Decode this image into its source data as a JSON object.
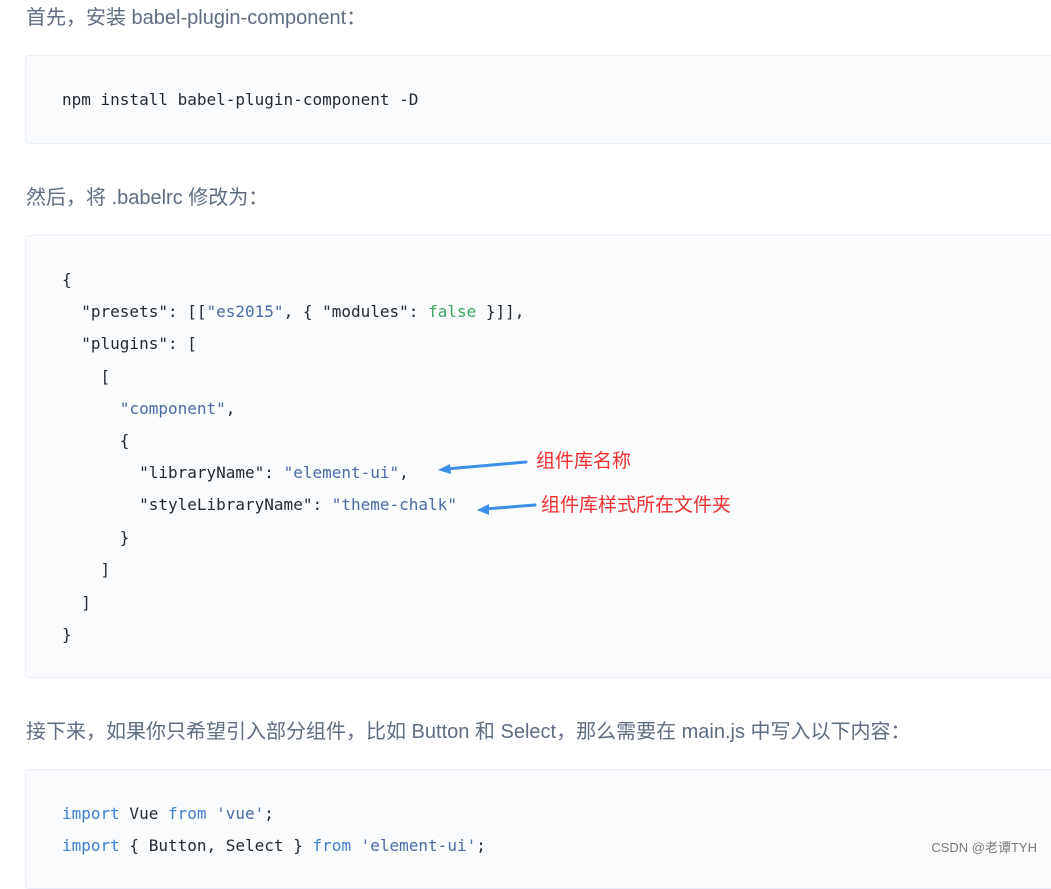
{
  "paragraphs": {
    "install_intro": "首先，安装 babel-plugin-component：",
    "babelrc_intro": "然后，将 .babelrc 修改为：",
    "import_intro": "接下来，如果你只希望引入部分组件，比如 Button 和 Select，那么需要在 main.js 中写入以下内容："
  },
  "install_command": "npm install babel-plugin-component -D",
  "babelrc_code": [
    "{",
    "  \"presets\": [[\"es2015\", { \"modules\": false }]],",
    "  \"plugins\": [",
    "    [",
    "      \"component\",",
    "      {",
    "        \"libraryName\": \"element-ui\",",
    "        \"styleLibraryName\": \"theme-chalk\"",
    "      }",
    "    ]",
    "  ]",
    "}"
  ],
  "tokens": {
    "open_brace": "{",
    "close_brace": "}",
    "open_bracket": "[",
    "close_bracket": "]",
    "presets_key": "\"presets\"",
    "presets_open": ": [[",
    "es2015": "\"es2015\"",
    "presets_mid": ", { ",
    "modules_key": "\"modules\"",
    "colon": ": ",
    "false_value": "false",
    "presets_close": " }]],",
    "plugins_key": "\"plugins\"",
    "plugins_open": ": [",
    "component": "\"component\"",
    "comma": ",",
    "library_key": "\"libraryName\"",
    "library_value": "\"element-ui\"",
    "style_key": "\"styleLibraryName\"",
    "style_value": "\"theme-chalk\""
  },
  "annotations": {
    "library_name_note": "组件库名称",
    "style_library_note": "组件库样式所在文件夹"
  },
  "main_js_code": [
    "import Vue from 'vue';",
    "import { Button, Select } from 'element-ui';"
  ],
  "main_js_tokens": {
    "import_kw": "import",
    "vue_ident": " Vue ",
    "from_kw": "from",
    "vue_str": " 'vue'",
    "semi": ";",
    "import_kw_2": "import",
    "destructure": " { Button, Select } ",
    "from_kw_2": "from",
    "element_str": " 'element-ui'",
    "semi_2": ";"
  },
  "watermark": "CSDN @老谭TYH",
  "colors": {
    "text": "#5e6d82",
    "code_bg": "#fafbfc",
    "code_border": "#eaeefb",
    "string": "#4b6aa8",
    "keyword": "#3f7fd0",
    "boolean": "#3aa55f",
    "annotation": "#f32f2f",
    "arrow": "#3d8ee6"
  }
}
